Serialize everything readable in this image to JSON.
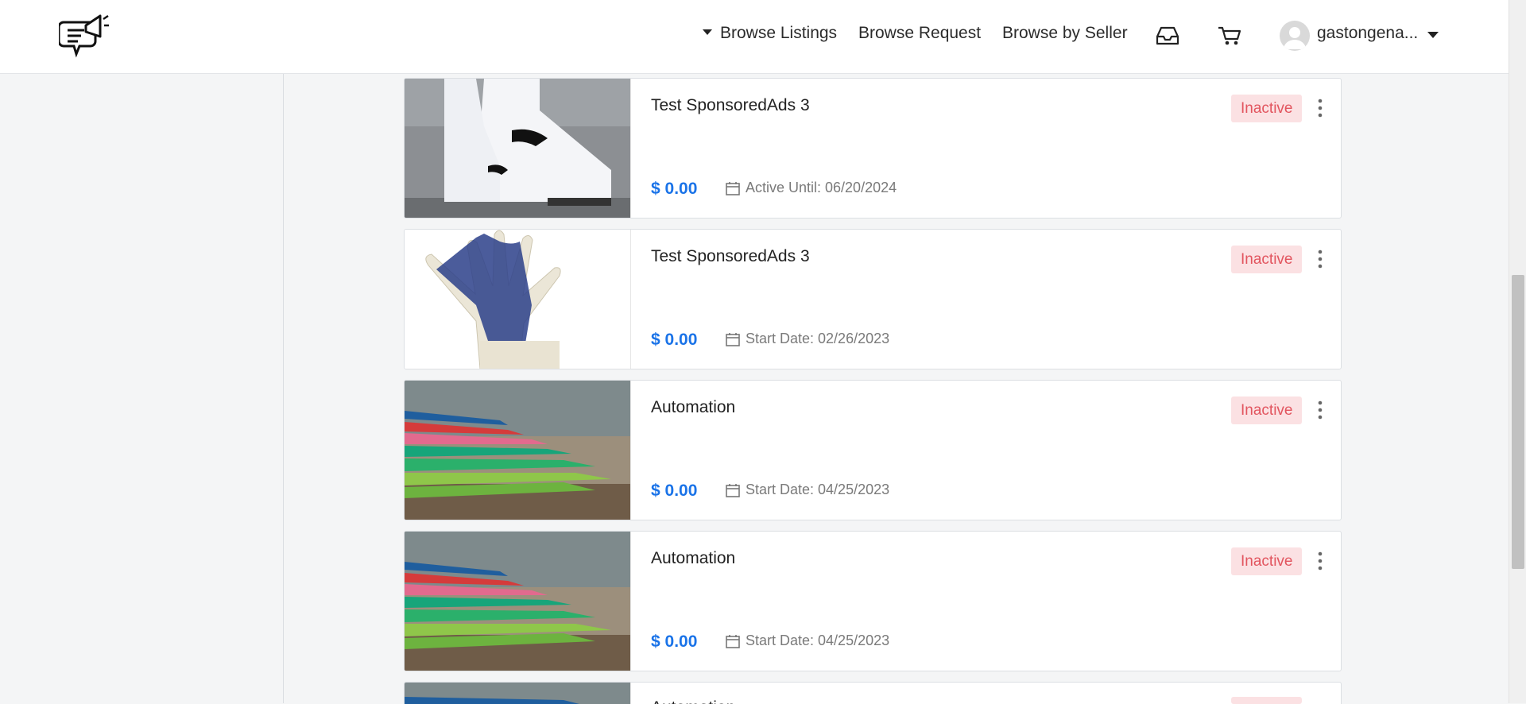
{
  "header": {
    "nav": {
      "browse_listings": "Browse Listings",
      "browse_request": "Browse Request",
      "browse_by_seller": "Browse by Seller"
    },
    "icons": {
      "inbox": "inbox-icon",
      "cart": "cart-icon",
      "logo": "megaphone-chat-logo"
    },
    "user_name": "gastongena..."
  },
  "listings": [
    {
      "title": "Test SponsoredAds 3",
      "price": "$ 0.00",
      "date": "Active Until: 06/20/2024",
      "status": "Inactive",
      "image": "white-sneakers"
    },
    {
      "title": "Test SponsoredAds 3",
      "price": "$ 0.00",
      "date": "Start Date: 02/26/2023",
      "status": "Inactive",
      "image": "work-glove"
    },
    {
      "title": "Automation",
      "price": "$ 0.00",
      "date": "Start Date: 04/25/2023",
      "status": "Inactive",
      "image": "colored-pencils"
    },
    {
      "title": "Automation",
      "price": "$ 0.00",
      "date": "Start Date: 04/25/2023",
      "status": "Inactive",
      "image": "colored-pencils"
    },
    {
      "title": "Automation",
      "price": "",
      "date": "",
      "status": "Inactive",
      "image": "colored-pencils"
    }
  ],
  "colors": {
    "price": "#1a73e8",
    "badge_bg": "#fbe1e3",
    "badge_text": "#e2555f"
  }
}
